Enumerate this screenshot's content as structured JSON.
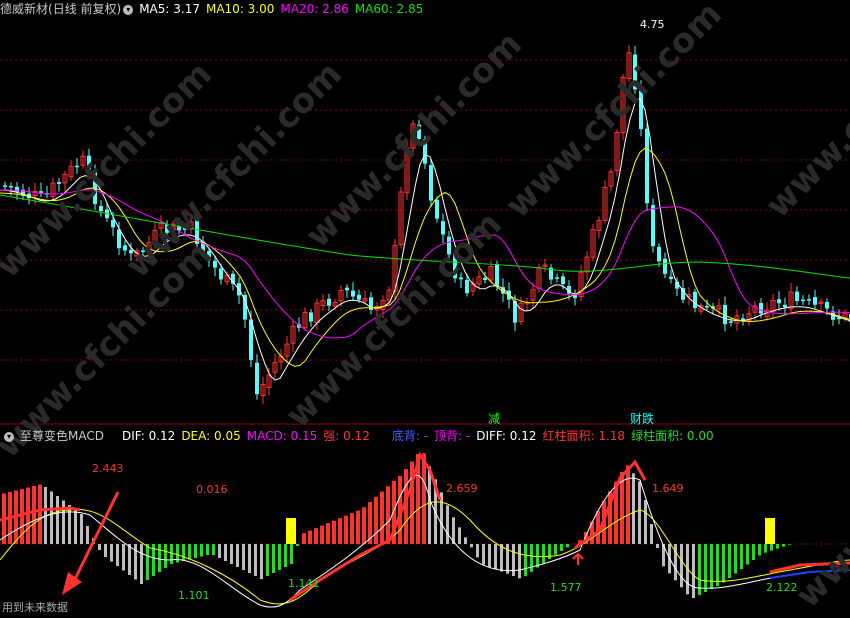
{
  "price_header": {
    "stock_name": "德威新材",
    "period": "(日线 前复权)",
    "ma5": "MA5: 3.17",
    "ma10": "MA10: 3.00",
    "ma20": "MA20: 2.86",
    "ma60": "MA60: 2.85"
  },
  "macd_header": {
    "title": "至尊变色MACD",
    "dif": "DIF: 0.12",
    "dea": "DEA: 0.05",
    "macd": "MACD: 0.15",
    "strong": "强: 0.12",
    "bottom_div": "底背: -",
    "top_div": "顶背: -",
    "diff": "DIFF: 0.12",
    "red_area": "红柱面积: 1.18",
    "green_area": "绿柱面积: 0.00"
  },
  "markers": {
    "jian": "减",
    "caidie": "财跌",
    "peak_price": "4.75"
  },
  "macd_labels": [
    "2.443",
    "0.016",
    "2.659",
    "1.649",
    "1.101",
    "1.141",
    "1.577",
    "2.122"
  ],
  "future_data_note": "用到未来数据",
  "watermark": "www.cfchi.com",
  "colors": {
    "up": "#ff3232",
    "down": "#54fcfc",
    "ma5": "#ffffff",
    "ma10": "#ffff00",
    "ma20": "#ff00ff",
    "ma60": "#00e600",
    "grid": "#8b0000",
    "bar_green": "#22dd22",
    "bar_gray": "#bdbdbd",
    "bar_yellow": "#ffff00"
  }
}
